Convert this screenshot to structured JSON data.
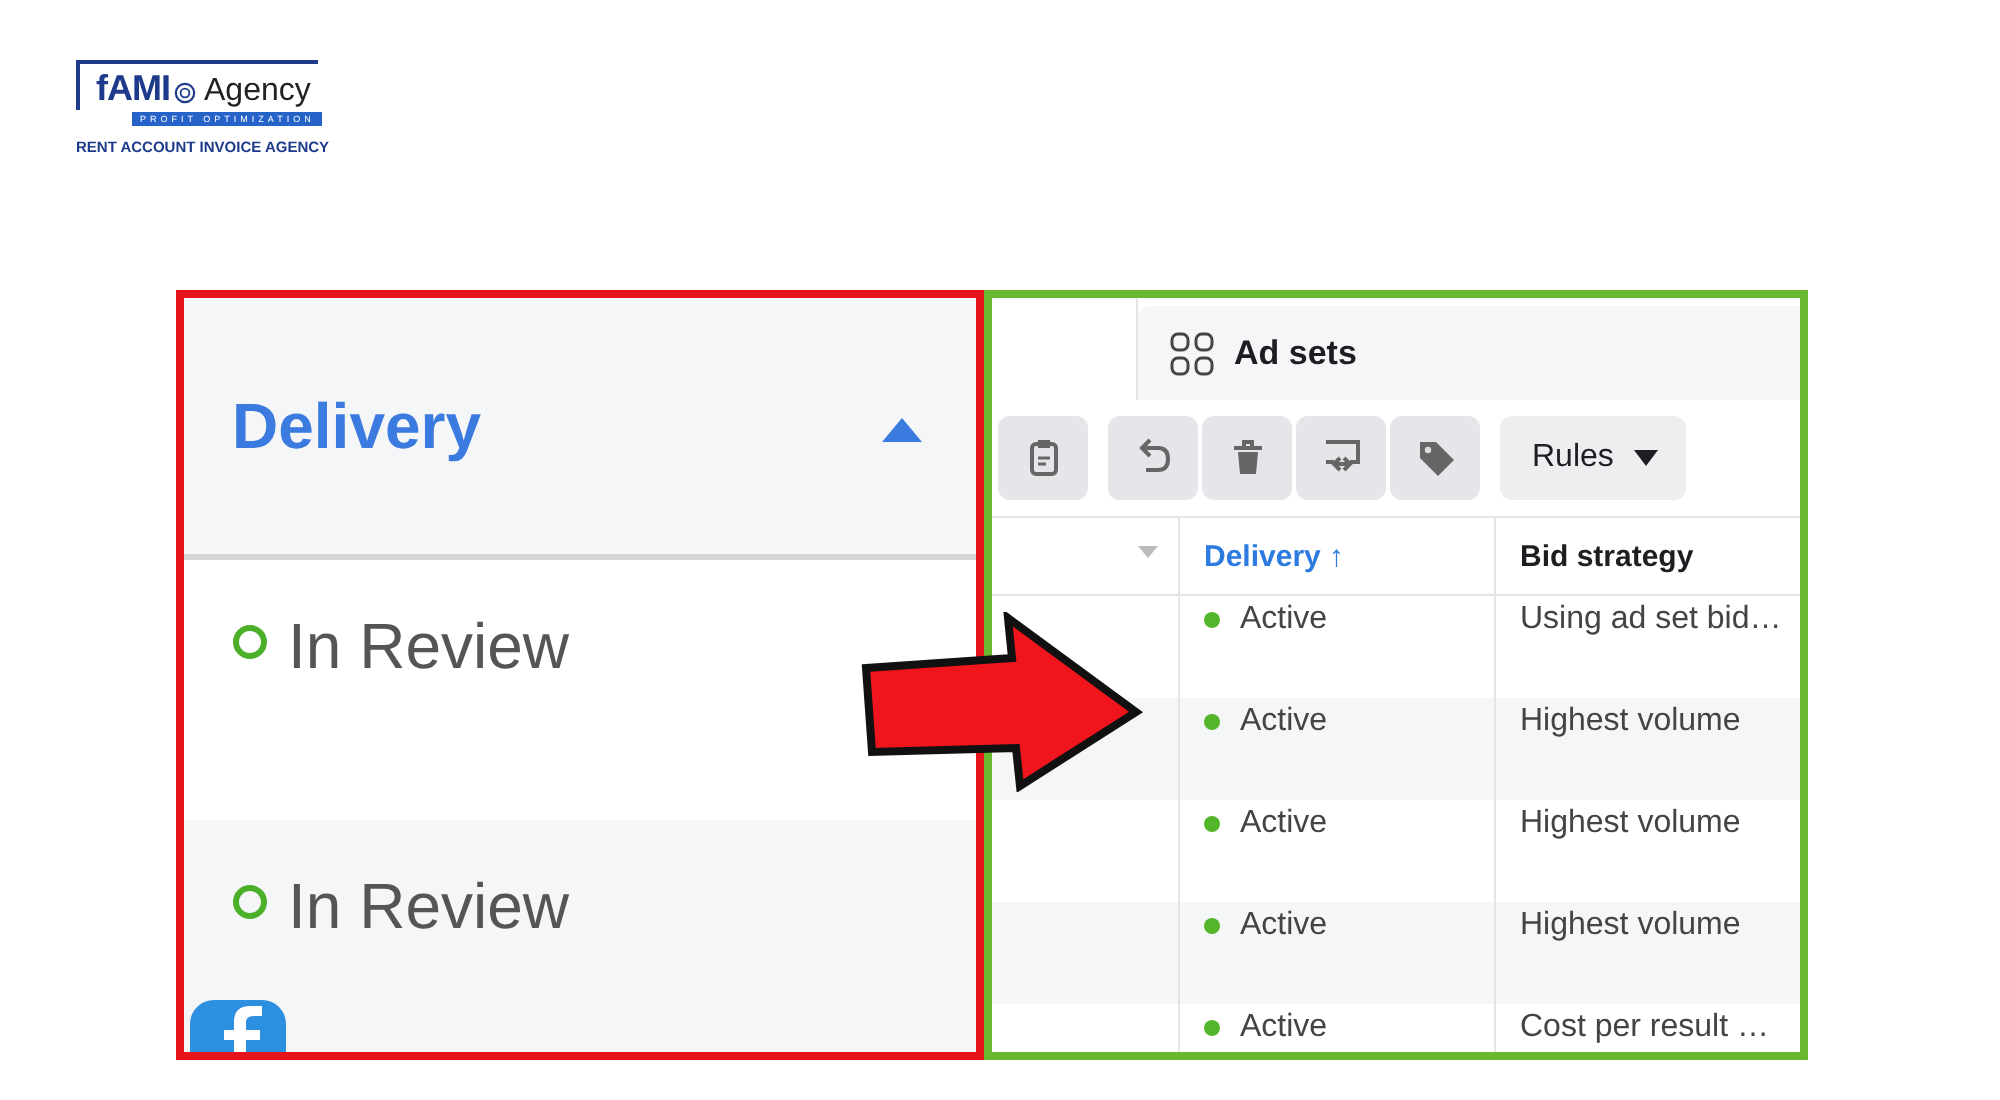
{
  "brand": {
    "name": "fAMI",
    "suffix": "Agency",
    "tagline": "PROFIT OPTIMIZATION",
    "subtitle": "RENT ACCOUNT INVOICE AGENCY"
  },
  "left_panel": {
    "header": "Delivery",
    "expanded": true,
    "rows": [
      {
        "status": "In Review"
      },
      {
        "status": "In Review"
      }
    ]
  },
  "right_panel": {
    "tab": "Ad sets",
    "rules_button": "Rules",
    "columns": [
      "Delivery ↑",
      "Bid strategy"
    ],
    "rows": [
      {
        "delivery": "Active",
        "bid_strategy": "Using ad set bid…"
      },
      {
        "delivery": "Active",
        "bid_strategy": "Highest volume"
      },
      {
        "delivery": "Active",
        "bid_strategy": "Highest volume"
      },
      {
        "delivery": "Active",
        "bid_strategy": "Highest volume"
      },
      {
        "delivery": "Active",
        "bid_strategy": "Cost per result …"
      }
    ]
  }
}
